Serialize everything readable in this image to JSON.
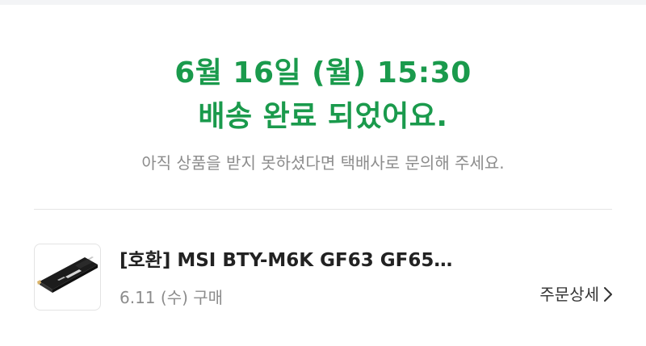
{
  "delivery": {
    "datetime_line": "6월 16일 (월) 15:30",
    "status_line": "배송 완료 되었어요."
  },
  "notice": "아직 상품을 받지 못하셨다면 택배사로 문의해 주세요.",
  "product": {
    "name": "[호환] MSI BTY-M6K GF63 GF65…",
    "purchase_date": "6.11 (수) 구매",
    "order_detail_label": "주문상세",
    "thumbnail_icon": "battery-product-icon"
  },
  "colors": {
    "accent_green": "#1a9a4c",
    "muted_text": "#8c8c8c"
  }
}
